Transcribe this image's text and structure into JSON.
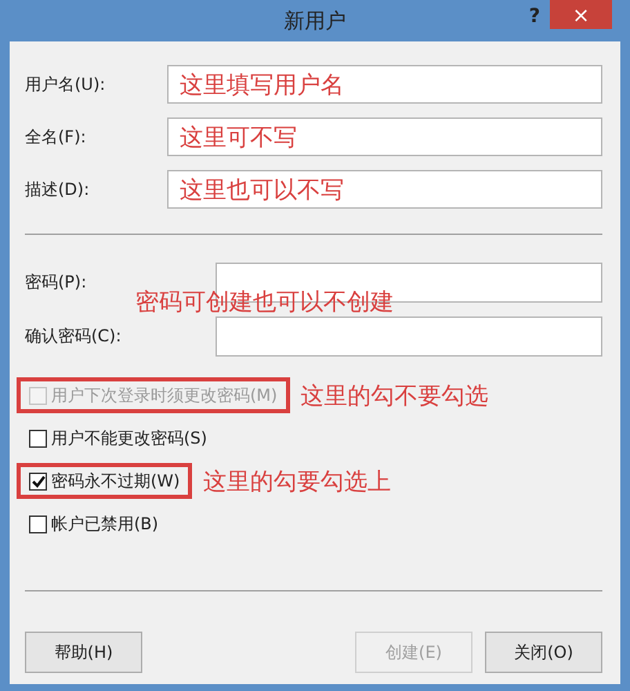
{
  "window": {
    "title": "新用户",
    "help": "?",
    "close": "×"
  },
  "fields": [
    {
      "label": "用户名(U):",
      "annotation": "这里填写用户名"
    },
    {
      "label": "全名(F):",
      "annotation": "这里可不写"
    },
    {
      "label": "描述(D):",
      "annotation": "这里也可以不写"
    }
  ],
  "password_fields": [
    {
      "label": "密码(P):"
    },
    {
      "label": "确认密码(C):"
    }
  ],
  "password_annotation": "密码可创建也可以不创建",
  "checkboxes": [
    {
      "label": "用户下次登录时须更改密码(M)",
      "checked": false,
      "disabled": true,
      "highlighted": true,
      "annotation": "这里的勾不要勾选"
    },
    {
      "label": "用户不能更改密码(S)",
      "checked": false,
      "disabled": false,
      "highlighted": false
    },
    {
      "label": "密码永不过期(W)",
      "checked": true,
      "disabled": false,
      "highlighted": true,
      "annotation": "这里的勾要勾选上"
    },
    {
      "label": "帐户已禁用(B)",
      "checked": false,
      "disabled": false,
      "highlighted": false
    }
  ],
  "buttons": [
    {
      "label": "帮助(H)",
      "disabled": false
    },
    {
      "label": "创建(E)",
      "disabled": true
    },
    {
      "label": "关闭(O)",
      "disabled": false
    }
  ]
}
